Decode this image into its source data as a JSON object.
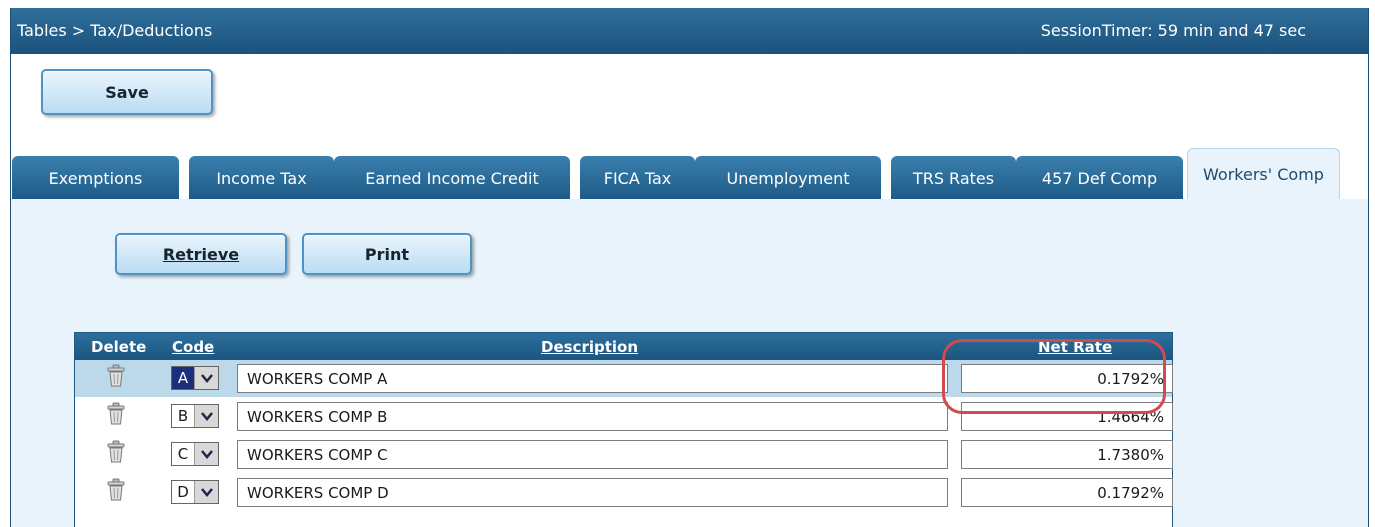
{
  "header": {
    "breadcrumb": "Tables > Tax/Deductions",
    "session_timer": "SessionTimer: 59 min and 47 sec"
  },
  "toolbar": {
    "save_label": "Save"
  },
  "tabs": [
    {
      "label": "Exemptions",
      "active": false
    },
    {
      "label": "Income Tax",
      "active": false
    },
    {
      "label": "Earned Income Credit",
      "active": false
    },
    {
      "label": "FICA Tax",
      "active": false
    },
    {
      "label": "Unemployment",
      "active": false
    },
    {
      "label": "TRS Rates",
      "active": false
    },
    {
      "label": "457 Def Comp",
      "active": false
    },
    {
      "label": "Workers' Comp",
      "active": true
    }
  ],
  "actions": {
    "retrieve_label": "Retrieve",
    "print_label": "Print"
  },
  "table": {
    "columns": {
      "delete": "Delete",
      "code": "Code",
      "description": "Description",
      "net_rate": "Net Rate"
    },
    "rows": [
      {
        "code": "A",
        "description": "WORKERS COMP A",
        "net_rate": "0.1792%",
        "selected": true
      },
      {
        "code": "B",
        "description": "WORKERS COMP B",
        "net_rate": "1.4664%",
        "selected": false
      },
      {
        "code": "C",
        "description": "WORKERS COMP C",
        "net_rate": "1.7380%",
        "selected": false
      },
      {
        "code": "D",
        "description": "WORKERS COMP D",
        "net_rate": "0.1792%",
        "selected": false
      }
    ]
  },
  "icons": {
    "delete_row": "trash-icon",
    "dropdown": "chevron-down-icon"
  },
  "colors": {
    "header_blue": "#1b527c",
    "panel_bg": "#e8f3fb",
    "highlight_ring": "#d24a4f",
    "selected_row": "#bcd9ec"
  }
}
